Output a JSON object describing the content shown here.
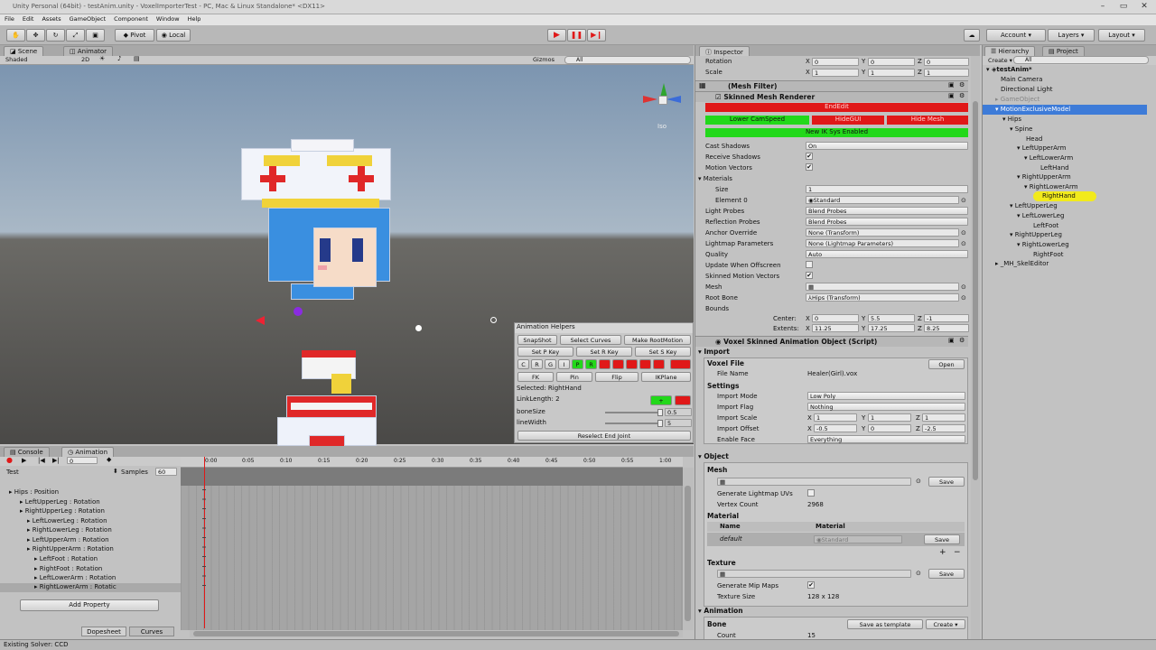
{
  "window": {
    "title": "Unity Personal (64bit) - testAnim.unity - VoxelImporterTest - PC, Mac & Linux Standalone* <DX11>"
  },
  "menu": [
    "File",
    "Edit",
    "Assets",
    "GameObject",
    "Component",
    "Window",
    "Help"
  ],
  "toolbar": {
    "pivot": "Pivot",
    "local": "Local",
    "account": "Account",
    "layers": "Layers",
    "layout": "Layout"
  },
  "scene": {
    "tab_scene": "Scene",
    "tab_animator": "Animator",
    "shading": "Shaded",
    "mode_2d": "2D",
    "gizmos": "Gizmos",
    "search_all": "All",
    "iso": "Iso"
  },
  "animation_helpers": {
    "title": "Animation Helpers",
    "row1": [
      "SnapShot",
      "Select Curves",
      "Make RootMotion"
    ],
    "row2": [
      "Set P Key",
      "Set R Key",
      "Set S Key"
    ],
    "row3": [
      "C",
      "R",
      "G",
      "I",
      "P",
      "R"
    ],
    "row4": [
      "FK",
      "Pin",
      "Flip",
      "IKPlane"
    ],
    "selected": "Selected: RightHand",
    "link_length": "LinkLength: 2",
    "plus": "+",
    "bone_size_label": "boneSize",
    "bone_size": "0.5",
    "line_width_label": "lineWidth",
    "line_width": "5",
    "reselect": "Reselect End Joint"
  },
  "animation": {
    "tab_console": "Console",
    "tab_animation": "Animation",
    "frame": "0",
    "clip": "Test",
    "samples_label": "Samples",
    "samples": "60",
    "ticks": [
      "0:00",
      "0:05",
      "0:10",
      "0:15",
      "0:20",
      "0:25",
      "0:30",
      "0:35",
      "0:40",
      "0:45",
      "0:50",
      "0:55",
      "1:00"
    ],
    "properties": [
      "Hips : Position",
      "LeftUpperLeg : Rotation",
      "RightUpperLeg : Rotation",
      "LeftLowerLeg : Rotation",
      "RightLowerLeg : Rotation",
      "LeftUpperArm : Rotation",
      "RightUpperArm : Rotation",
      "LeftFoot : Rotation",
      "RightFoot : Rotation",
      "LeftLowerArm : Rotation",
      "RightLowerArm : Rotatic"
    ],
    "add_property": "Add Property",
    "dopesheet": "Dopesheet",
    "curves": "Curves"
  },
  "inspector": {
    "tab": "Inspector",
    "rotation": {
      "label": "Rotation",
      "x": "0",
      "y": "0",
      "z": "0"
    },
    "scale": {
      "label": "Scale",
      "x": "1",
      "y": "1",
      "z": "1"
    },
    "mesh_filter": "(Mesh Filter)",
    "skinned": "Skinned Mesh Renderer",
    "end_edit": "EndEdit",
    "lower_cam": "Lower CamSpeed",
    "hide_gui": "HideGUI",
    "hide_mesh": "Hide Mesh",
    "new_ik": "New IK Sys Enabled",
    "props": [
      {
        "label": "Cast Shadows",
        "value": "On"
      },
      {
        "label": "Receive Shadows",
        "value": "✔"
      },
      {
        "label": "Motion Vectors",
        "value": "✔"
      }
    ],
    "materials": "Materials",
    "size_label": "Size",
    "size": "1",
    "element0_label": "Element 0",
    "element0": "Standard",
    "props2": [
      {
        "label": "Light Probes",
        "value": "Blend Probes"
      },
      {
        "label": "Reflection Probes",
        "value": "Blend Probes"
      },
      {
        "label": "Anchor Override",
        "value": "None (Transform)"
      },
      {
        "label": "Lightmap Parameters",
        "value": "None (Lightmap Parameters)"
      },
      {
        "label": "Quality",
        "value": "Auto"
      }
    ],
    "update_offscreen": "Update When Offscreen",
    "skinned_motion": "Skinned Motion Vectors",
    "mesh_label": "Mesh",
    "root_bone_label": "Root Bone",
    "root_bone": "Hips (Transform)",
    "bounds": "Bounds",
    "center": {
      "label": "Center",
      "x": "0",
      "y": "5.5",
      "z": "-1"
    },
    "extents": {
      "label": "Extents",
      "x": "11.25",
      "y": "17.25",
      "z": "8.25"
    },
    "script": "Voxel Skinned Animation Object (Script)",
    "import": "Import",
    "voxel_file": "Voxel File",
    "file_name_label": "File Name",
    "file_name": "Healer(Girl).vox",
    "open": "Open",
    "settings": "Settings",
    "import_mode_label": "Import Mode",
    "import_mode": "Low Poly",
    "import_flag_label": "Import Flag",
    "import_flag": "Nothing",
    "import_scale_label": "Import Scale",
    "import_scale": {
      "x": "1",
      "y": "1",
      "z": "1"
    },
    "import_offset_label": "Import Offset",
    "import_offset": {
      "x": "-0.5",
      "y": "0",
      "z": "-2.5"
    },
    "enable_face_label": "Enable Face",
    "enable_face": "Everything",
    "object": "Object",
    "mesh_sec": "Mesh",
    "save": "Save",
    "gen_uvs": "Generate Lightmap UVs",
    "vertex_count_label": "Vertex Count",
    "vertex_count": "2968",
    "material_sec": "Material",
    "name_col": "Name",
    "material_col": "Material",
    "default_name": "default",
    "default_mat": "Standard",
    "plus": "+",
    "minus": "−",
    "texture": "Texture",
    "gen_mips": "Generate Mip Maps",
    "tex_size_label": "Texture Size",
    "tex_size": "128 x 128",
    "animation_sec": "Animation",
    "bone": "Bone",
    "save_template": "Save as template",
    "create": "Create",
    "count_label": "Count",
    "count": "15",
    "axis": {
      "x": "X",
      "y": "Y",
      "z": "Z"
    }
  },
  "hierarchy": {
    "tab_hierarchy": "Hierarchy",
    "tab_project": "Project",
    "create": "Create",
    "search": "All",
    "scene": "testAnim*",
    "items": [
      {
        "label": "Main Camera",
        "depth": 0
      },
      {
        "label": "Directional Light",
        "depth": 0
      },
      {
        "label": "GameObject",
        "depth": 0
      },
      {
        "label": "MotionExclusiveModel",
        "depth": 0
      },
      {
        "label": "Hips",
        "depth": 1
      },
      {
        "label": "Spine",
        "depth": 2
      },
      {
        "label": "Head",
        "depth": 3
      },
      {
        "label": "LeftUpperArm",
        "depth": 3
      },
      {
        "label": "LeftLowerArm",
        "depth": 4
      },
      {
        "label": "LeftHand",
        "depth": 5
      },
      {
        "label": "RightUpperArm",
        "depth": 3
      },
      {
        "label": "RightLowerArm",
        "depth": 4
      },
      {
        "label": "RightHand",
        "depth": 5
      },
      {
        "label": "LeftUpperLeg",
        "depth": 2
      },
      {
        "label": "LeftLowerLeg",
        "depth": 3
      },
      {
        "label": "LeftFoot",
        "depth": 4
      },
      {
        "label": "RightUpperLeg",
        "depth": 2
      },
      {
        "label": "RightLowerLeg",
        "depth": 3
      },
      {
        "label": "RightFoot",
        "depth": 4
      },
      {
        "label": "_MH_SkelEditor",
        "depth": 0
      }
    ]
  },
  "status": "Existing Solver: CCD",
  "colors": {
    "red": "#e01818",
    "green": "#22d81a",
    "selected": "#3d7bd8",
    "highlight": "#f2ea1c"
  }
}
